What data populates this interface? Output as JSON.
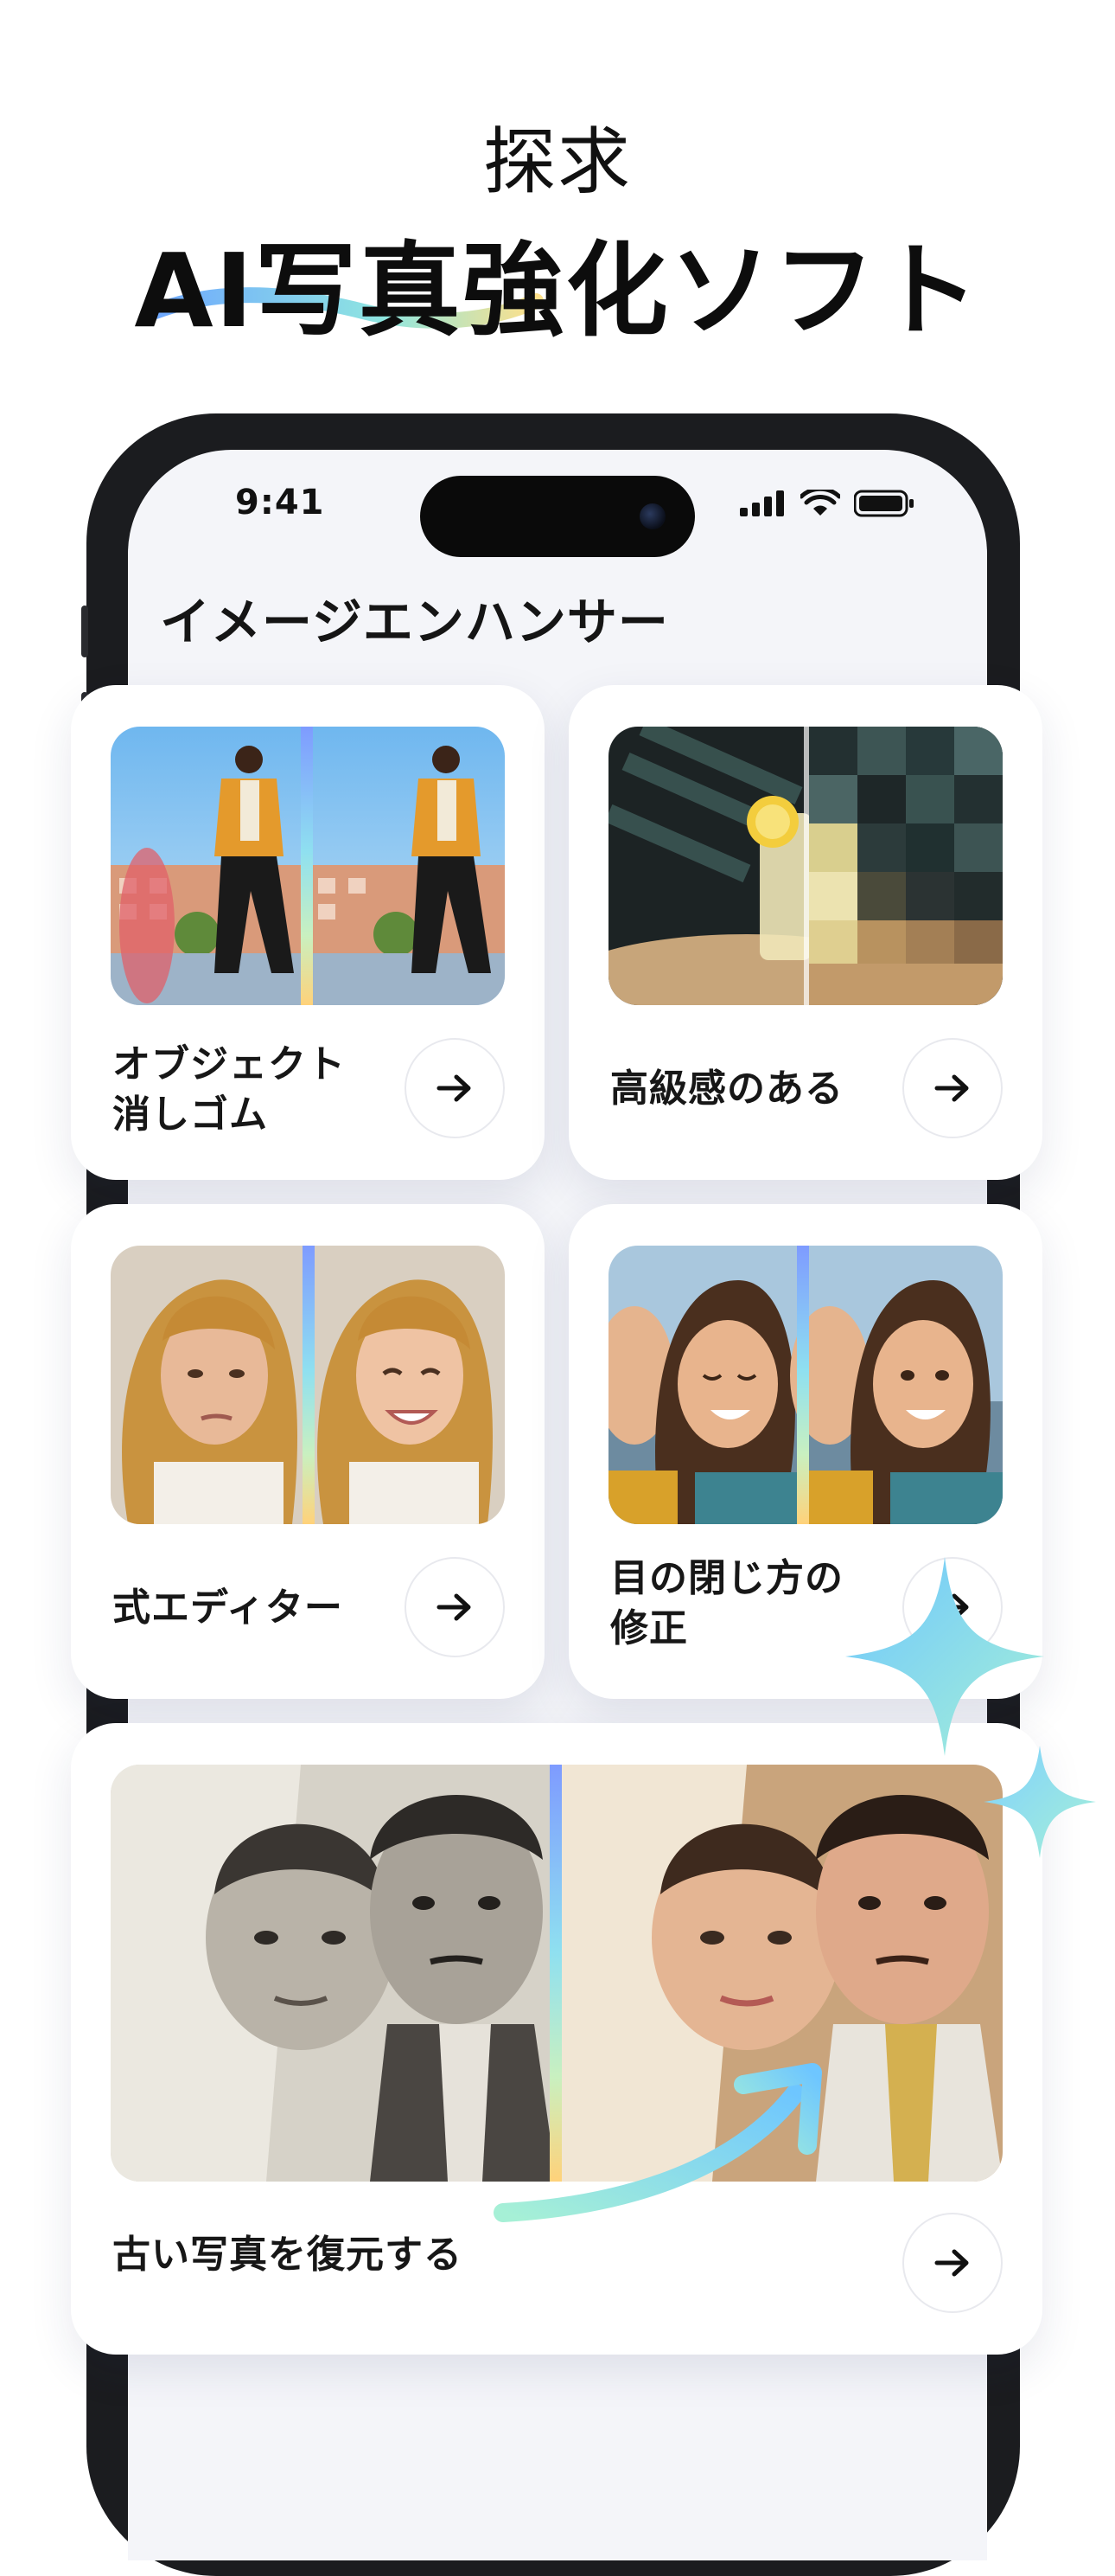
{
  "hero": {
    "subtitle": "探求",
    "title": "AI写真強化ソフト"
  },
  "status_bar": {
    "time": "9:41",
    "icons": [
      "signal-icon",
      "wifi-icon",
      "battery-icon"
    ]
  },
  "app": {
    "title": "イメージエンハンサー"
  },
  "features": [
    {
      "label_line1": "オブジェクト",
      "label_line2": "消しゴム",
      "action": "arrow-right-icon"
    },
    {
      "label_line1": "高級感のある",
      "label_line2": "",
      "action": "arrow-right-icon"
    },
    {
      "label_line1": "式エディター",
      "label_line2": "",
      "action": "arrow-right-icon"
    },
    {
      "label_line1": "目の閉じ方の",
      "label_line2": "修正",
      "action": "arrow-right-icon"
    },
    {
      "label_line1": "古い写真を復元する",
      "label_line2": "",
      "action": "arrow-right-icon"
    }
  ],
  "colors": {
    "accent_gradient": [
      "#7e9bff",
      "#8fe0f0",
      "#c9f0c0",
      "#ffd27a"
    ],
    "sparkle_gradient": [
      "#6ec6ff",
      "#a6f0d6"
    ]
  }
}
